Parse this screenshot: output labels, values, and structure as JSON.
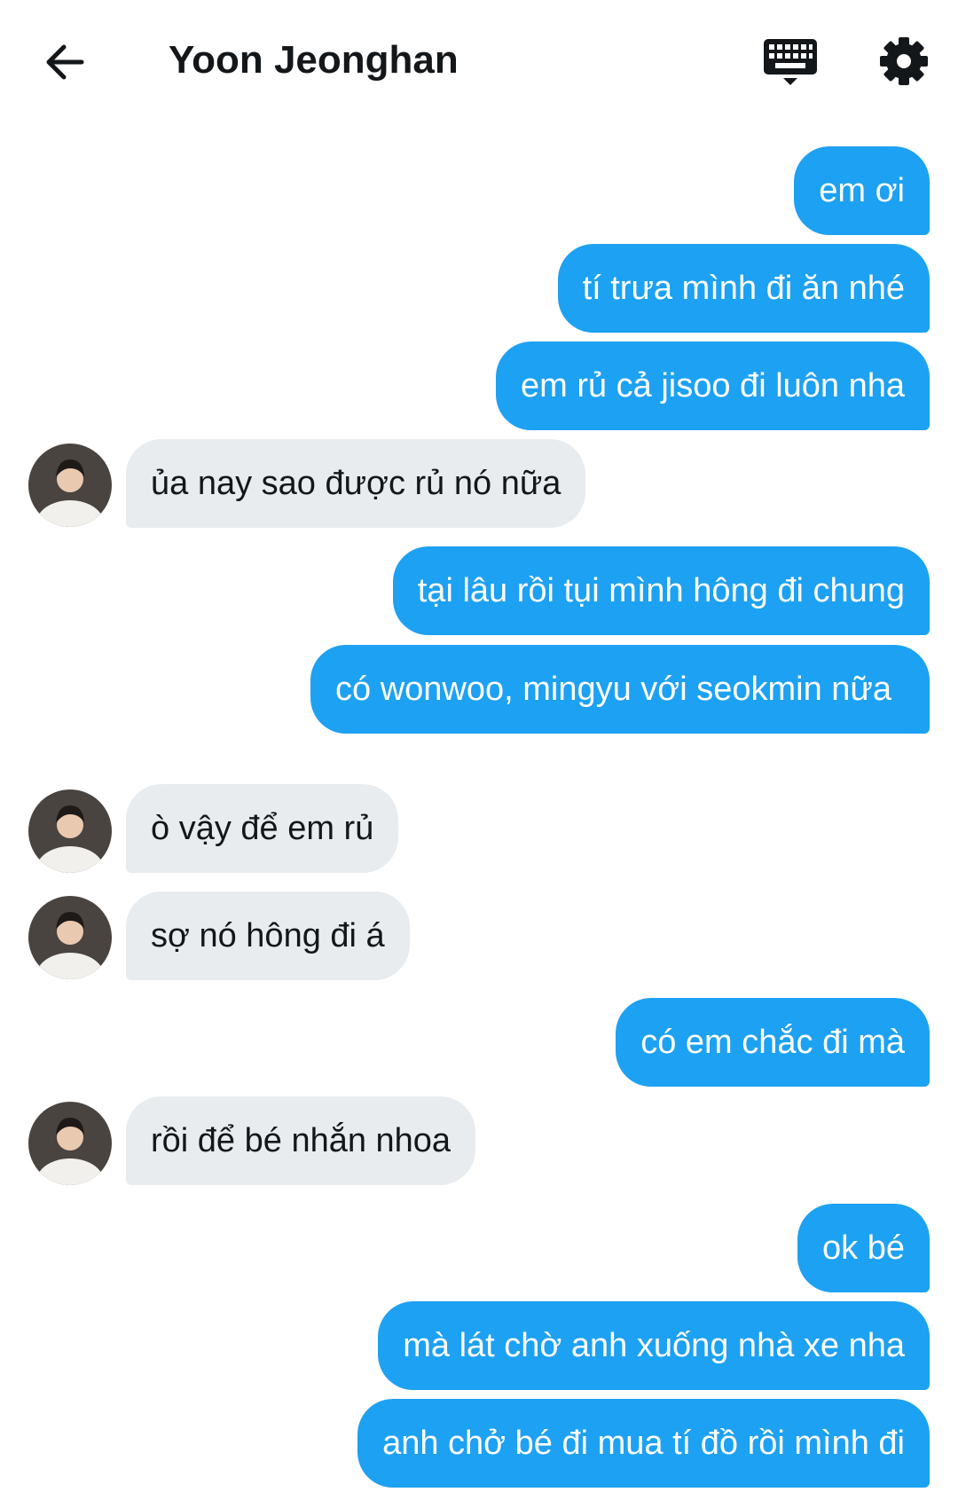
{
  "header": {
    "title": "Yoon Jeonghan",
    "back_icon": "arrow-left-icon",
    "keyboard_icon": "keyboard-icon",
    "settings_icon": "gear-icon"
  },
  "colors": {
    "sent_bubble": "#1da1f2",
    "received_bubble": "#e8ecef"
  },
  "messages": [
    {
      "from": "me",
      "text": "em ơi"
    },
    {
      "from": "me",
      "text": "tí trưa mình đi ăn nhé"
    },
    {
      "from": "me",
      "text": "em rủ cả jisoo đi luôn nha"
    },
    {
      "from": "them",
      "text": "ủa nay sao được rủ nó nữa"
    },
    {
      "from": "me",
      "text": "tại lâu rồi tụi mình hông đi chung"
    },
    {
      "from": "me",
      "text": "có wonwoo, mingyu với seokmin nữa"
    },
    {
      "from": "them",
      "text": "ò vậy để em rủ"
    },
    {
      "from": "them",
      "text": "sợ nó hông đi á"
    },
    {
      "from": "me",
      "text": "có em chắc đi mà"
    },
    {
      "from": "them",
      "text": "rồi để bé nhắn nhoa"
    },
    {
      "from": "me",
      "text": "ok bé"
    },
    {
      "from": "me",
      "text": "mà lát chờ anh xuống nhà xe nha"
    },
    {
      "from": "me",
      "text": "anh chở bé đi mua tí đồ rồi mình đi"
    }
  ]
}
